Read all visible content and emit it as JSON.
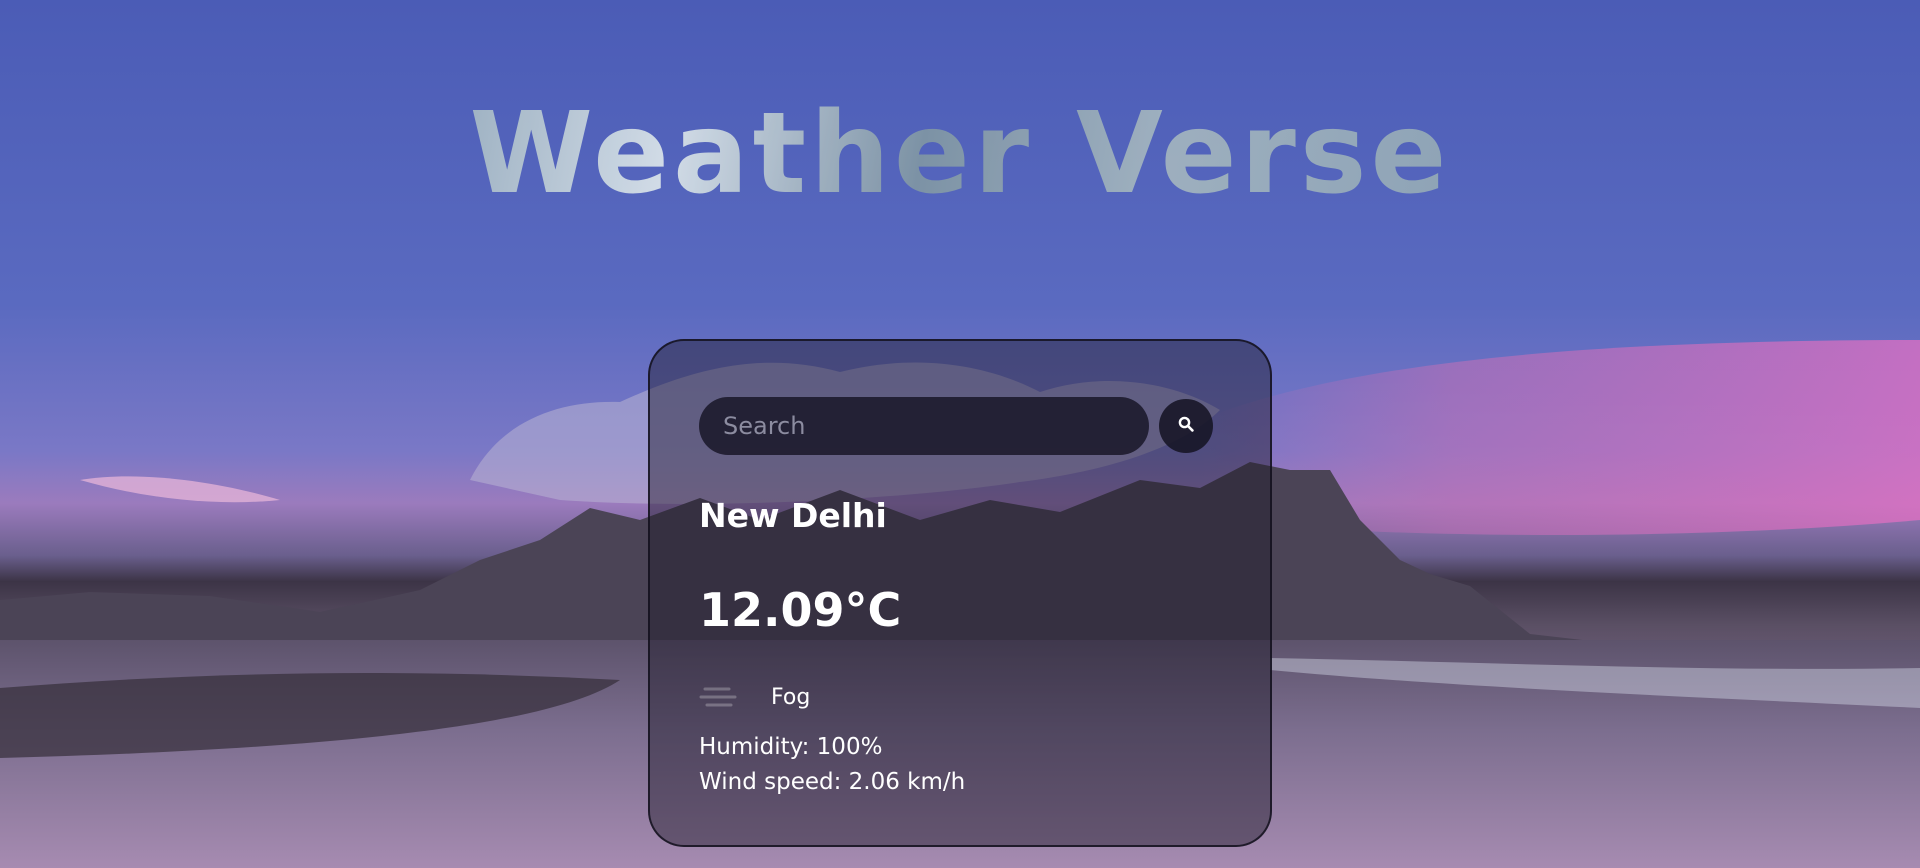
{
  "app": {
    "title": "Weather Verse"
  },
  "search": {
    "placeholder": "Search",
    "value": "",
    "button_icon": "search-icon"
  },
  "weather": {
    "city": "New Delhi",
    "temperature": "12.09°C",
    "condition": "Fog",
    "condition_icon": "fog-icon",
    "humidity": "Humidity: 100%",
    "wind_speed": "Wind speed: 2.06 km/h"
  },
  "colors": {
    "sky_top": "#4b5cb6",
    "horizon_pink": "#c46fb7",
    "card_background": "#1c1828",
    "text": "#ffffff"
  }
}
